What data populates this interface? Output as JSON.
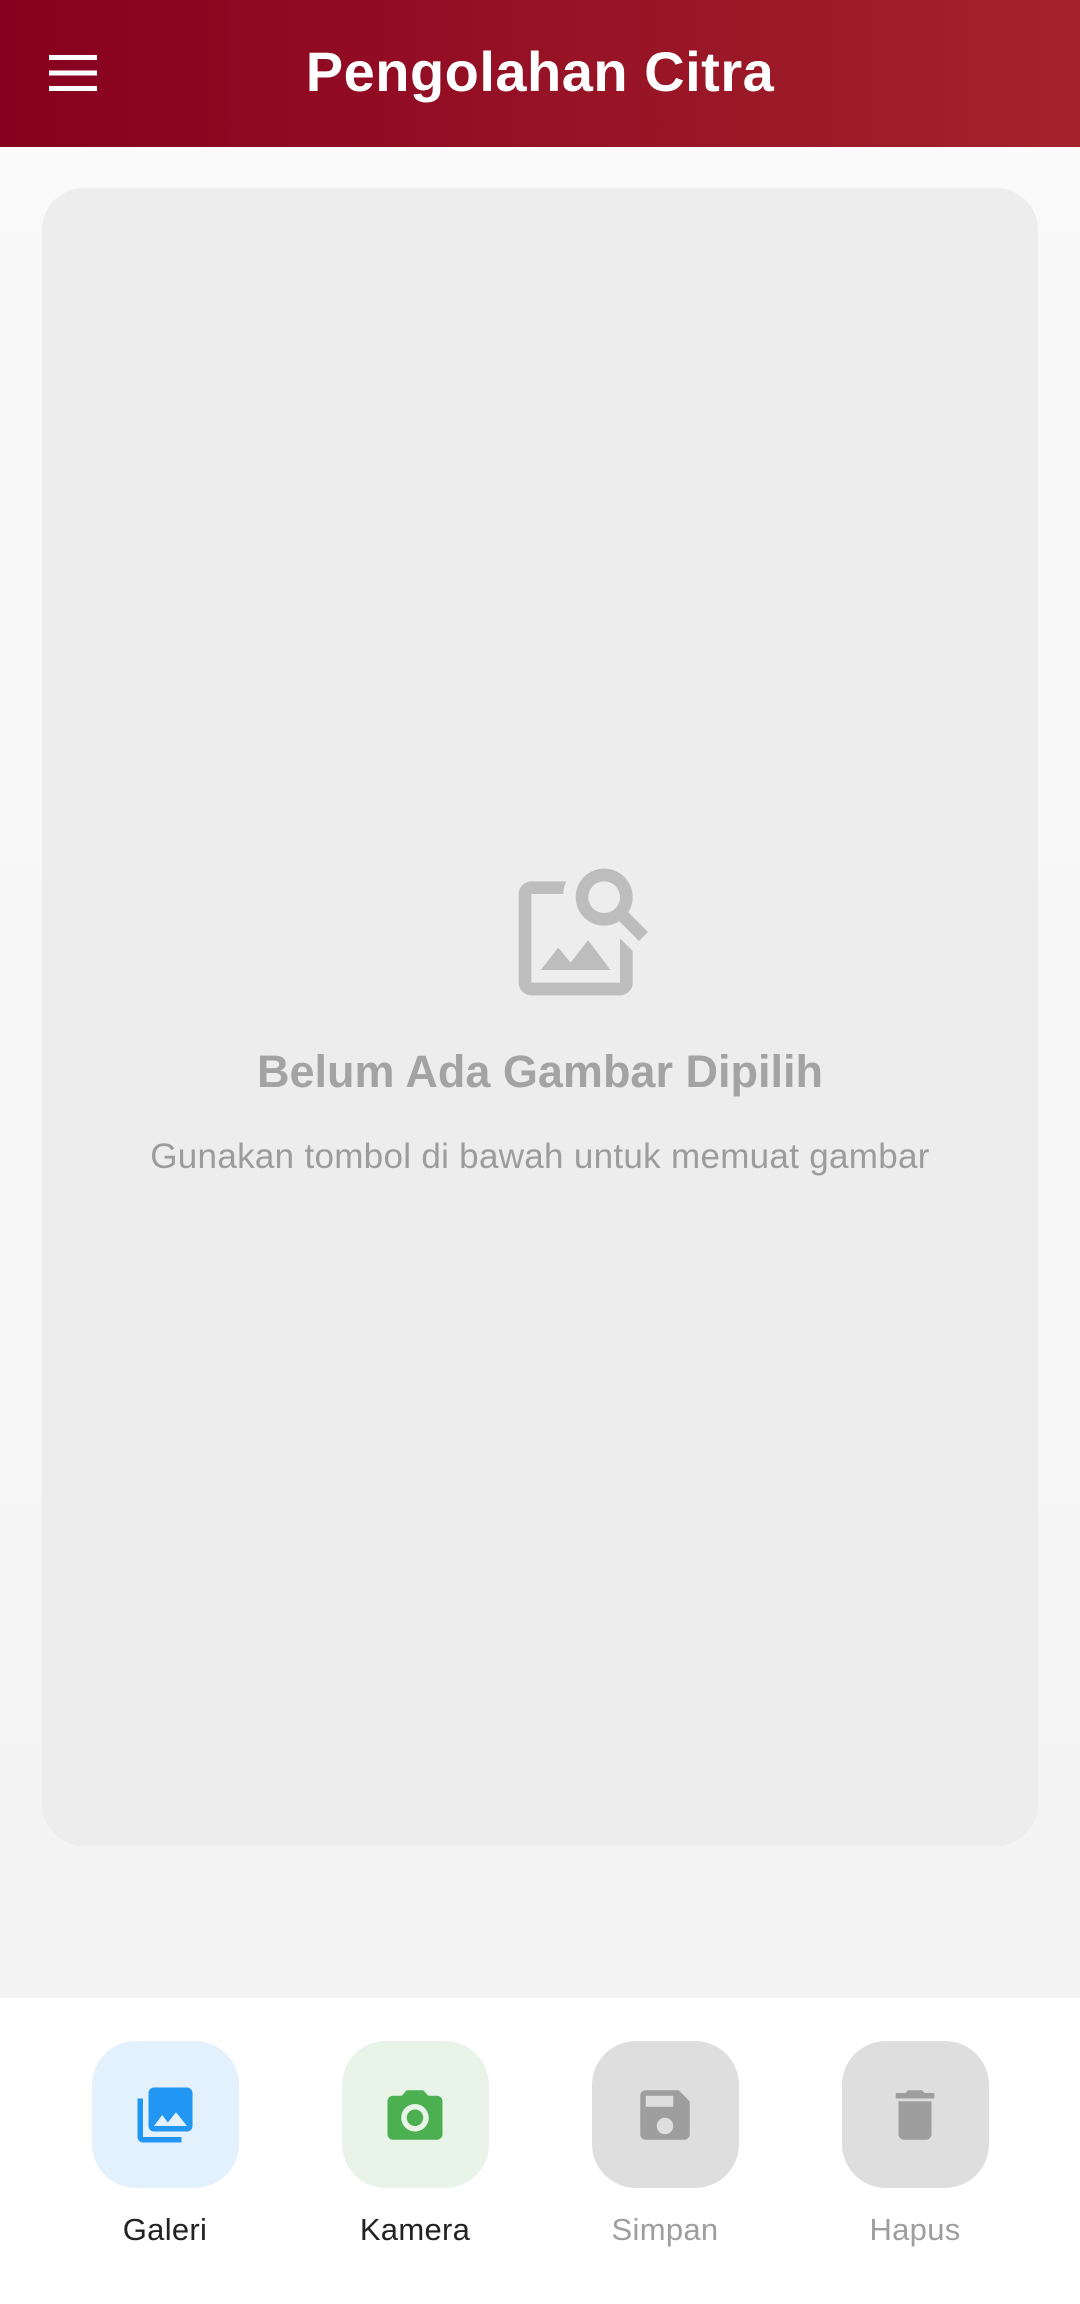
{
  "app_bar": {
    "title": "Pengolahan Citra",
    "menu_icon": "hamburger-menu-icon",
    "gradient_start": "#87001f",
    "gradient_end": "#a4232b"
  },
  "preview": {
    "icon": "image-search-icon",
    "title": "Belum Ada Gambar Dipilih",
    "subtitle": "Gunakan tombol di bawah untuk memuat gambar"
  },
  "actions": [
    {
      "label": "Galeri",
      "icon": "photo-library-icon",
      "enabled": true,
      "icon_color": "#2196f3",
      "tile_color": "#e3f1fc"
    },
    {
      "label": "Kamera",
      "icon": "camera-icon",
      "enabled": true,
      "icon_color": "#4caf50",
      "tile_color": "#e8f4e8"
    },
    {
      "label": "Simpan",
      "icon": "save-icon",
      "enabled": false,
      "icon_color": "#9e9e9e",
      "tile_color": "#dedede"
    },
    {
      "label": "Hapus",
      "icon": "delete-icon",
      "enabled": false,
      "icon_color": "#9e9e9e",
      "tile_color": "#dedede"
    }
  ]
}
